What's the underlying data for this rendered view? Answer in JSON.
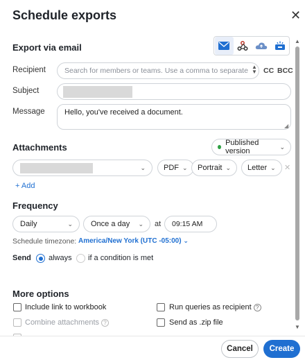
{
  "dialog": {
    "title": "Schedule exports",
    "close_icon": "close-icon"
  },
  "export": {
    "heading": "Export via email",
    "channels": [
      "email-icon",
      "webhook-icon",
      "cloud-upload-icon",
      "inbox-icon"
    ],
    "recipient_label": "Recipient",
    "recipient_placeholder": "Search for members or teams. Use a comma to separate",
    "cc": "CC",
    "bcc": "BCC",
    "subject_label": "Subject",
    "message_label": "Message",
    "message_value": "Hello, you've received a document."
  },
  "attachments": {
    "heading": "Attachments",
    "version": "Published version",
    "version_status_color": "#2ea043",
    "format": "PDF",
    "orientation": "Portrait",
    "paper": "Letter",
    "add_label": "+ Add"
  },
  "frequency": {
    "heading": "Frequency",
    "period": "Daily",
    "repeat": "Once a day",
    "at_label": "at",
    "time": "09:15 AM",
    "tz_label": "Schedule timezone:",
    "tz_value": "America/New York (UTC -05:00)",
    "send_label": "Send",
    "send_always": "always",
    "send_condition": "if a condition is met"
  },
  "more": {
    "heading": "More options",
    "include_link": "Include link to workbook",
    "run_as_recipient": "Run queries as recipient",
    "combine": "Combine attachments",
    "send_zip": "Send as .zip file"
  },
  "footer": {
    "cancel": "Cancel",
    "create": "Create"
  },
  "colors": {
    "accent": "#1f6fd1"
  }
}
